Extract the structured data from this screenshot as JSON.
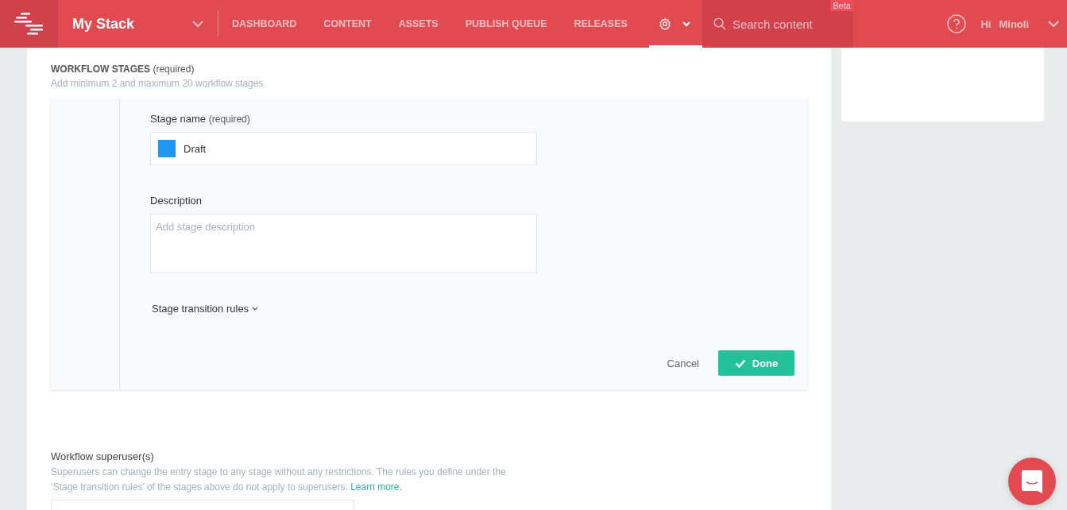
{
  "header": {
    "stack_name": "My Stack",
    "nav": [
      {
        "kind": "text",
        "label": "DASHBOARD",
        "selected": false
      },
      {
        "kind": "text",
        "label": "CONTENT",
        "selected": false
      },
      {
        "kind": "text",
        "label": "ASSETS",
        "selected": false
      },
      {
        "kind": "text",
        "label": "PUBLISH QUEUE",
        "selected": false
      },
      {
        "kind": "text",
        "label": "RELEASES",
        "selected": false
      },
      {
        "kind": "settings",
        "selected": true
      }
    ],
    "search": {
      "placeholder": "Search content",
      "badge": "Beta"
    },
    "greeting": "Hi",
    "user": "Minoli"
  },
  "workflow_stages": {
    "title": "WORKFLOW STAGES",
    "title_note": "(required)",
    "hint": "Add minimum 2 and maximum 20 workflow stages",
    "stage": {
      "name_label": "Stage name",
      "name_note": "(required)",
      "name": "Draft",
      "color": "#2196f3",
      "description_label": "Description",
      "description_placeholder": "Add stage description",
      "transition_rules": "Stage transition rules",
      "cancel": "Cancel",
      "done": "Done"
    }
  },
  "superusers": {
    "title": "Workflow superuser(s)",
    "description": "Superusers can change the entry stage to any stage without any restrictions. The rules you define under the ‘Stage transition rules’ of the stages above do not apply to superusers.",
    "link": "Learn more."
  }
}
